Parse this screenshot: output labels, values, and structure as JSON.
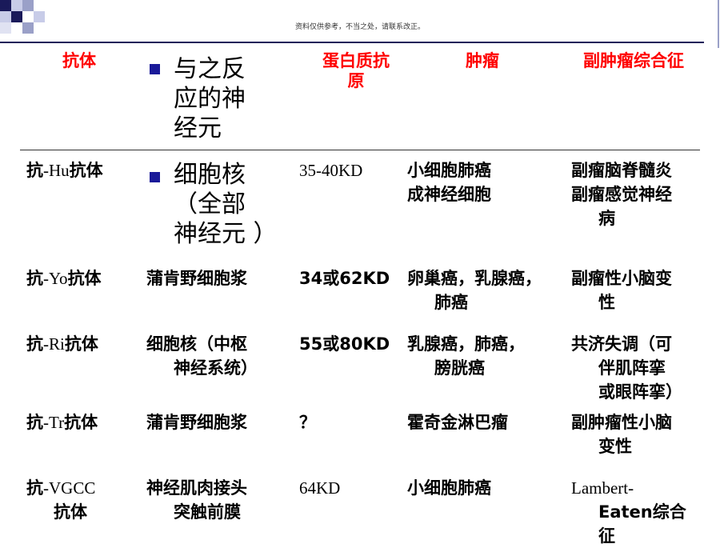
{
  "header_note": "资料仅供参考，不当之处，请联系改正。",
  "columns": [
    "抗体",
    "与之反应的神经元",
    "蛋白质抗原",
    "肿瘤",
    "副肿瘤综合征"
  ],
  "col2_header_lines": [
    "与之反",
    "应的神",
    "经元"
  ],
  "col3_header_lines": [
    "蛋白质抗",
    "原"
  ],
  "rows": [
    {
      "antibody_prefix": "抗",
      "antibody_latin": "-Hu",
      "antibody_suffix": "抗体",
      "neuron_lines": [
        "细胞核",
        "（全部",
        "神经元 ）"
      ],
      "antigen": "35-40KD",
      "tumor_lines": [
        "小细胞肺癌",
        "成神经细胞"
      ],
      "syndrome_lines": [
        "副瘤脑脊髓炎",
        "副瘤感觉神经",
        "病"
      ]
    },
    {
      "antibody_prefix": "抗",
      "antibody_latin": "-Yo",
      "antibody_suffix": "抗体",
      "neuron": "蒲肯野细胞浆",
      "antigen": "34或62KD",
      "tumor_lines": [
        "卵巢癌，乳腺癌，",
        "肺癌"
      ],
      "syndrome_lines": [
        "副瘤性小脑变",
        "性"
      ]
    },
    {
      "antibody_prefix": "抗",
      "antibody_latin": "-Ri",
      "antibody_suffix": "抗体",
      "neuron_lines": [
        "细胞核（中枢",
        "神经系统）"
      ],
      "antigen": "55或80KD",
      "tumor_lines": [
        "乳腺癌，肺癌，",
        "膀胱癌"
      ],
      "syndrome_lines": [
        "共济失调（可",
        "伴肌阵挛",
        "或眼阵挛）"
      ]
    },
    {
      "antibody_prefix": "抗",
      "antibody_latin": "-Tr",
      "antibody_suffix": "抗体",
      "neuron": "蒲肯野细胞浆",
      "antigen": "？",
      "tumor": "霍奇金淋巴瘤",
      "syndrome_lines": [
        "副肿瘤性小脑",
        "变性"
      ]
    },
    {
      "antibody_prefix": "抗",
      "antibody_latin": "-VGCC",
      "antibody_line2": "抗体",
      "neuron_lines": [
        "神经肌肉接头",
        "突触前膜"
      ],
      "antigen": "64KD",
      "tumor": "小细胞肺癌",
      "syndrome_lines": [
        "Lambert-",
        "Eaten综合",
        "征"
      ]
    }
  ],
  "colors": {
    "header_text": "#ff0000",
    "bullet": "#1a1a99",
    "rule": "#1a1a5a"
  }
}
